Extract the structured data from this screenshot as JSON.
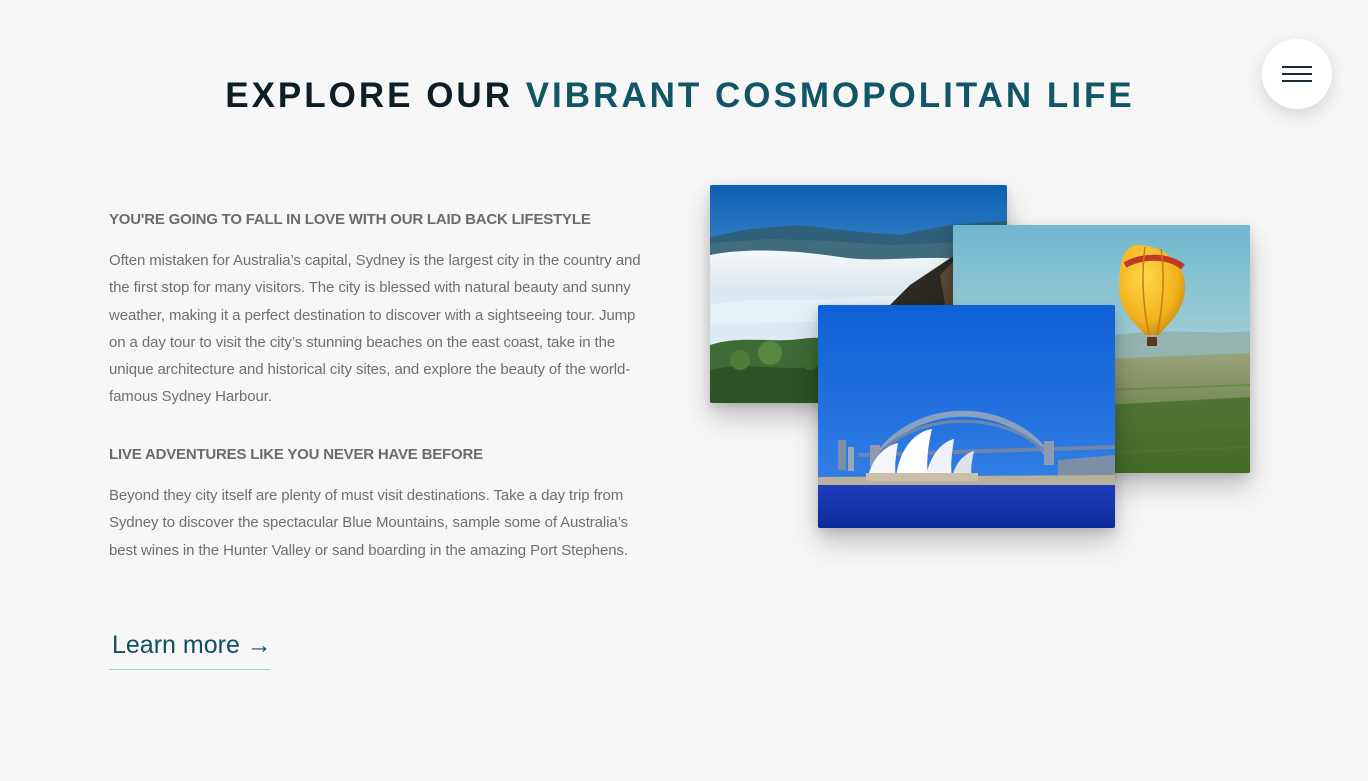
{
  "header": {
    "headline_dark": "EXPLORE OUR ",
    "headline_teal": "VIBRANT COSMOPOLITAN LIFE"
  },
  "menu": {
    "icon": "hamburger-menu-icon"
  },
  "content": {
    "section1_heading": "YOU'RE GOING TO FALL IN LOVE WITH OUR LAID BACK LIFESTYLE",
    "section1_text": "Often mistaken for Australia’s capital, Sydney is the largest city in the country and the first stop for many visitors. The city is blessed with natural beauty and sunny weather, making it a perfect destination to discover with a sightseeing tour. Jump on a day tour to visit the city’s stunning beaches on the east coast, take in the unique architecture and historical city sites, and explore the beauty of the world-famous Sydney Harbour.",
    "section2_heading": "LIVE ADVENTURES LIKE YOU NEVER HAVE BEFORE",
    "section2_text": "Beyond they city itself are plenty of must visit destinations. Take a day trip from Sydney to discover the spectacular Blue Mountains, sample some of Australia’s best wines in the Hunter Valley or sand boarding in the amazing Port Stephens."
  },
  "cta": {
    "learn_more": "Learn more →"
  },
  "colors": {
    "background": "#f7f7f7",
    "headline_dark": "#0d1e26",
    "headline_teal": "#115666",
    "link": "#0f4f5f",
    "link_underline": "#9fd0d8",
    "body_text": "#6f6f6f"
  }
}
